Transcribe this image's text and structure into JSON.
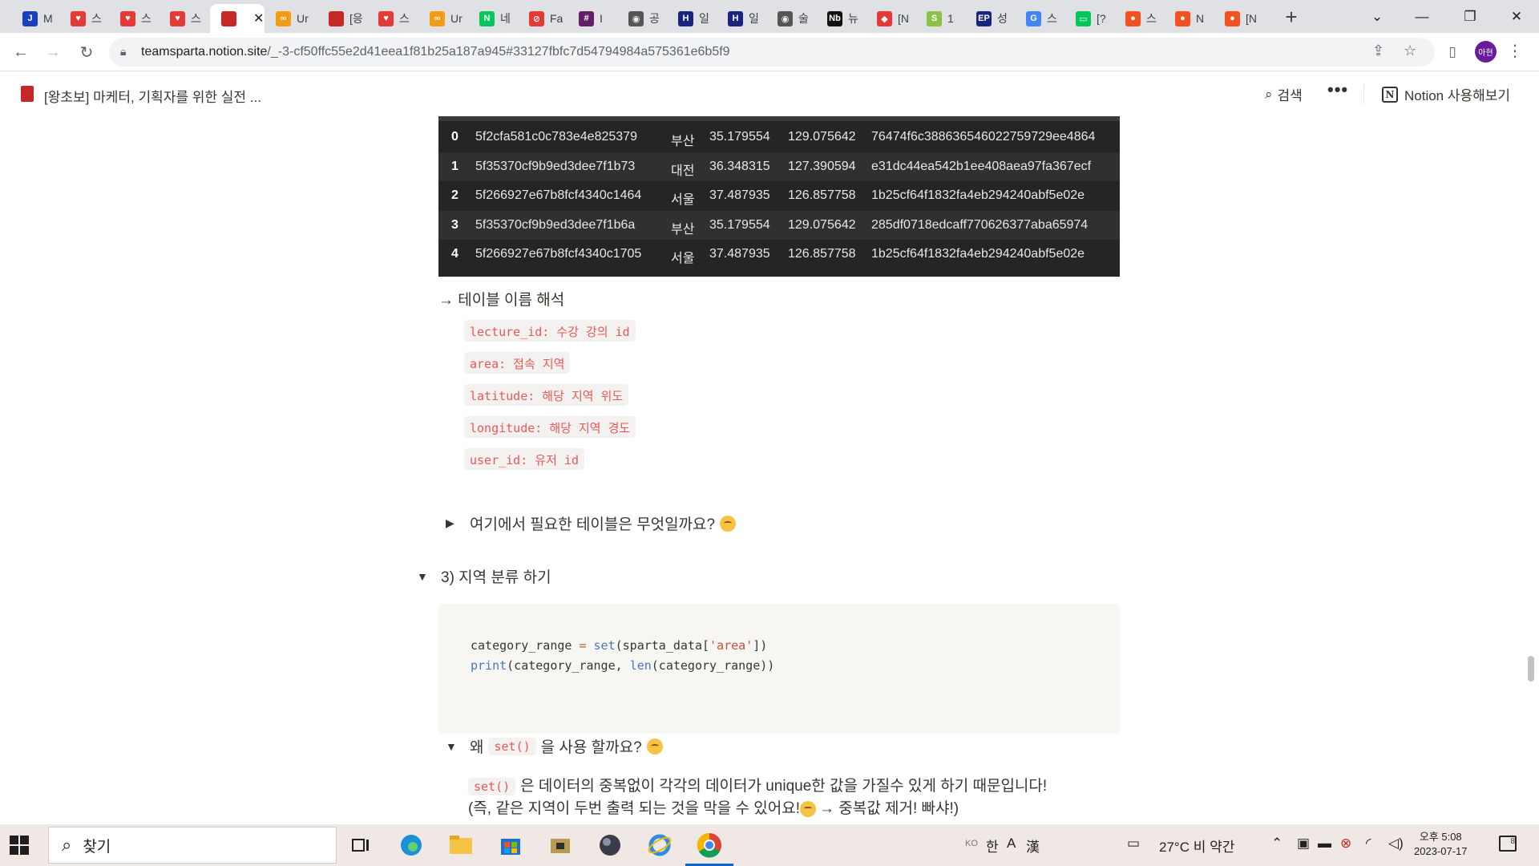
{
  "browser": {
    "tabs": [
      {
        "label": "M",
        "fav": "J",
        "color": "#1a3fbf"
      },
      {
        "label": "스",
        "fav": "♥",
        "color": "#e53935"
      },
      {
        "label": "스",
        "fav": "♥",
        "color": "#e53935"
      },
      {
        "label": "스",
        "fav": "♥",
        "color": "#e53935"
      },
      {
        "label": "",
        "fav": "",
        "color": "#c62828",
        "active": true
      },
      {
        "label": "Ur",
        "fav": "∞",
        "color": "#f39c12"
      },
      {
        "label": "[응",
        "fav": "",
        "color": "#c62828"
      },
      {
        "label": "스",
        "fav": "♥",
        "color": "#e53935"
      },
      {
        "label": "Ur",
        "fav": "∞",
        "color": "#f39c12"
      },
      {
        "label": "네",
        "fav": "N",
        "color": "#03c75a"
      },
      {
        "label": "Fa",
        "fav": "⊘",
        "color": "#e53935"
      },
      {
        "label": "I",
        "fav": "#",
        "color": "#611f69"
      },
      {
        "label": "공",
        "fav": "◉",
        "color": "#555555"
      },
      {
        "label": "일",
        "fav": "H",
        "color": "#1a237e"
      },
      {
        "label": "일",
        "fav": "H",
        "color": "#1a237e"
      },
      {
        "label": "술",
        "fav": "◉",
        "color": "#555555"
      },
      {
        "label": "뉴",
        "fav": "Nb",
        "color": "#111111"
      },
      {
        "label": "[N",
        "fav": "◆",
        "color": "#e53935"
      },
      {
        "label": "1",
        "fav": "S",
        "color": "#8bc34a"
      },
      {
        "label": "성",
        "fav": "EP",
        "color": "#1a237e"
      },
      {
        "label": "스",
        "fav": "G",
        "color": "#4285f4"
      },
      {
        "label": "[?",
        "fav": "▭",
        "color": "#03c75a"
      },
      {
        "label": "스",
        "fav": "●",
        "color": "#f4511e"
      },
      {
        "label": "N",
        "fav": "●",
        "color": "#f4511e"
      },
      {
        "label": "[N",
        "fav": "●",
        "color": "#f4511e"
      }
    ],
    "new_tab": "+",
    "url_host": "teamsparta.notion.site",
    "url_path": "/_-3-cf50ffc55e2d41eea1f81b25a187a945#33127fbfc7d54794984a575361e6b5f9",
    "profile_initials": "아현"
  },
  "notion": {
    "page_title": "[왕초보] 마케터, 기획자를 위한 실전 ...",
    "search_label": "검색",
    "more_label": "•••",
    "try_notion_label": "Notion 사용해보기"
  },
  "dataframe": {
    "rows": [
      {
        "idx": "0",
        "lecture_id": "5f2cfa581c0c783e4e825379",
        "area": "부산",
        "latitude": "35.179554",
        "longitude": "129.075642",
        "user_id": "76474f6c388636546022759729ee4864"
      },
      {
        "idx": "1",
        "lecture_id": "5f35370cf9b9ed3dee7f1b73",
        "area": "대전",
        "latitude": "36.348315",
        "longitude": "127.390594",
        "user_id": "e31dc44ea542b1ee408aea97fa367ecf"
      },
      {
        "idx": "2",
        "lecture_id": "5f266927e67b8fcf4340c1464",
        "area": "서울",
        "latitude": "37.487935",
        "longitude": "126.857758",
        "user_id": "1b25cf64f1832fa4eb294240abf5e02e"
      },
      {
        "idx": "3",
        "lecture_id": "5f35370cf9b9ed3dee7f1b6a",
        "area": "부산",
        "latitude": "35.179554",
        "longitude": "129.075642",
        "user_id": "285df0718edcaff770626377aba65974"
      },
      {
        "idx": "4",
        "lecture_id": "5f266927e67b8fcf4340c1705",
        "area": "서울",
        "latitude": "37.487935",
        "longitude": "126.857758",
        "user_id": "1b25cf64f1832fa4eb294240abf5e02e"
      }
    ]
  },
  "content": {
    "table_heading": "→ 테이블 이름 해석",
    "column_chips": [
      "lecture_id: 수강 강의 id",
      "area: 접속 지역",
      "latitude: 해당 지역 위도",
      "longitude: 해당 지역 경도",
      "user_id: 유저 id"
    ],
    "toggle_needed_tables": "여기에서 필요한 테이블은 무엇일까요?",
    "section_heading": "3) 지역 분류 하기",
    "code": {
      "line1_var": "category_range ",
      "line1_eq": "=",
      "line1_fn": "set",
      "line1_arg_open": "(sparta_data[",
      "line1_str": "'area'",
      "line1_close": "])",
      "line2_fn": "print",
      "line2_mid": "(category_range, ",
      "line2_fn2": "len",
      "line2_end": "(category_range))"
    },
    "why_set_prefix": "왜",
    "why_set_code": "set()",
    "why_set_suffix": "을 사용 할까요?",
    "answer_code": "set()",
    "answer_line1": "은 데이터의 중복없이 각각의 데이터가 unique한 값을 가질수 있게 하기 때문입니다!",
    "answer_line2_a": "(즉, 같은 지역이 두번 출력 되는 것을 막을 수 있어요!",
    "answer_line2_b": "→ 중복값 제거! 빠샤!)"
  },
  "taskbar": {
    "search_placeholder": "찾기",
    "ime_ko": "KO",
    "ime_han": "한",
    "ime_a": "A",
    "ime_hanja": "漢",
    "weather": "27°C  비 약간",
    "clock_ampm_time": "오후 5:08",
    "clock_date": "2023-07-17",
    "notif_count": "8"
  }
}
